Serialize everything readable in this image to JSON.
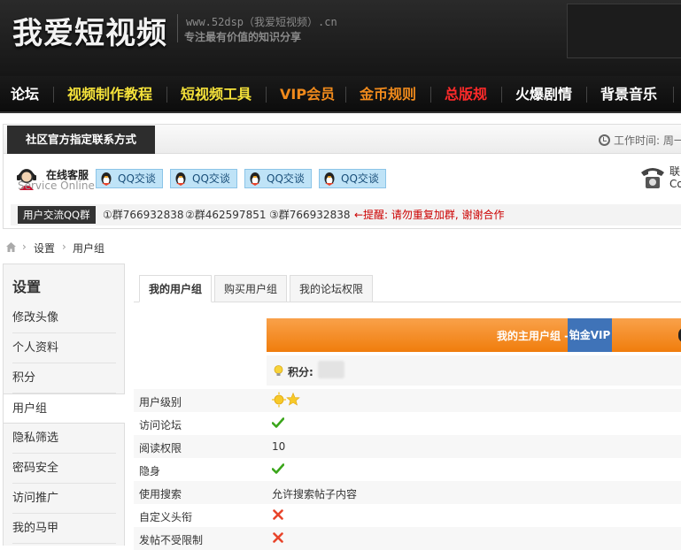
{
  "header": {
    "logo_text": "我爱短视频",
    "site_url": "www.52dsp（我爱短视频）.cn",
    "slogan": "专注最有价值的知识分享"
  },
  "nav": [
    {
      "label": "论坛",
      "color": "#ffffff"
    },
    {
      "label": "视频制作教程",
      "color": "#f5e23a"
    },
    {
      "label": "短视频工具",
      "color": "#f5e23a"
    },
    {
      "label": "VIP会员",
      "color": "#f08a1c"
    },
    {
      "label": "金币规则",
      "color": "#f08a1c"
    },
    {
      "label": "总版规",
      "color": "#ff2a2a"
    },
    {
      "label": "火爆剧情",
      "color": "#ffffff"
    },
    {
      "label": "背景音乐",
      "color": "#ffffff"
    }
  ],
  "contact": {
    "tab_label": "社区官方指定联系方式",
    "work_time": "工作时间: 周一",
    "cs_title": "在线客服",
    "cs_sub": "Service Online",
    "qq_buttons": [
      "QQ交谈",
      "QQ交谈",
      "QQ交谈",
      "QQ交谈"
    ],
    "phone_line1": "联",
    "phone_line2": "Co",
    "groups_tag": "用户交流QQ群",
    "groups": [
      "①群766932838",
      "②群462597851",
      "③群766932838"
    ],
    "warning": "←提醒: 请勿重复加群, 谢谢合作"
  },
  "breadcrumb": {
    "sep": "›",
    "items": [
      "设置",
      "用户组"
    ]
  },
  "sidebar": {
    "title": "设置",
    "items": [
      "修改头像",
      "个人资料",
      "积分",
      "用户组",
      "隐私筛选",
      "密码安全",
      "访问推广",
      "我的马甲"
    ],
    "active_index": 3
  },
  "tabs": [
    "我的用户组",
    "购买用户组",
    "我的论坛权限"
  ],
  "banner": {
    "label": "我的主用户组 -",
    "vip": "铂金VIP"
  },
  "points_label": "积分:",
  "permissions": [
    {
      "label": "用户级别",
      "type": "level"
    },
    {
      "label": "访问论坛",
      "type": "check"
    },
    {
      "label": "阅读权限",
      "type": "text",
      "value": "10"
    },
    {
      "label": "隐身",
      "type": "check"
    },
    {
      "label": "使用搜索",
      "type": "text",
      "value": "允许搜索帖子内容"
    },
    {
      "label": "自定义头衔",
      "type": "cross"
    },
    {
      "label": "发帖不受限制",
      "type": "cross"
    }
  ],
  "colors": {
    "check": "#3aa51a",
    "cross": "#e8442b",
    "banner_orange": "#f07d0c",
    "banner_blue": "#3f73b8",
    "qq_button": "#bfe3f7"
  },
  "icons": {
    "work_time": "clock-icon",
    "home": "home-icon",
    "points": "lightbulb-icon",
    "level": "sun-star-icon"
  }
}
